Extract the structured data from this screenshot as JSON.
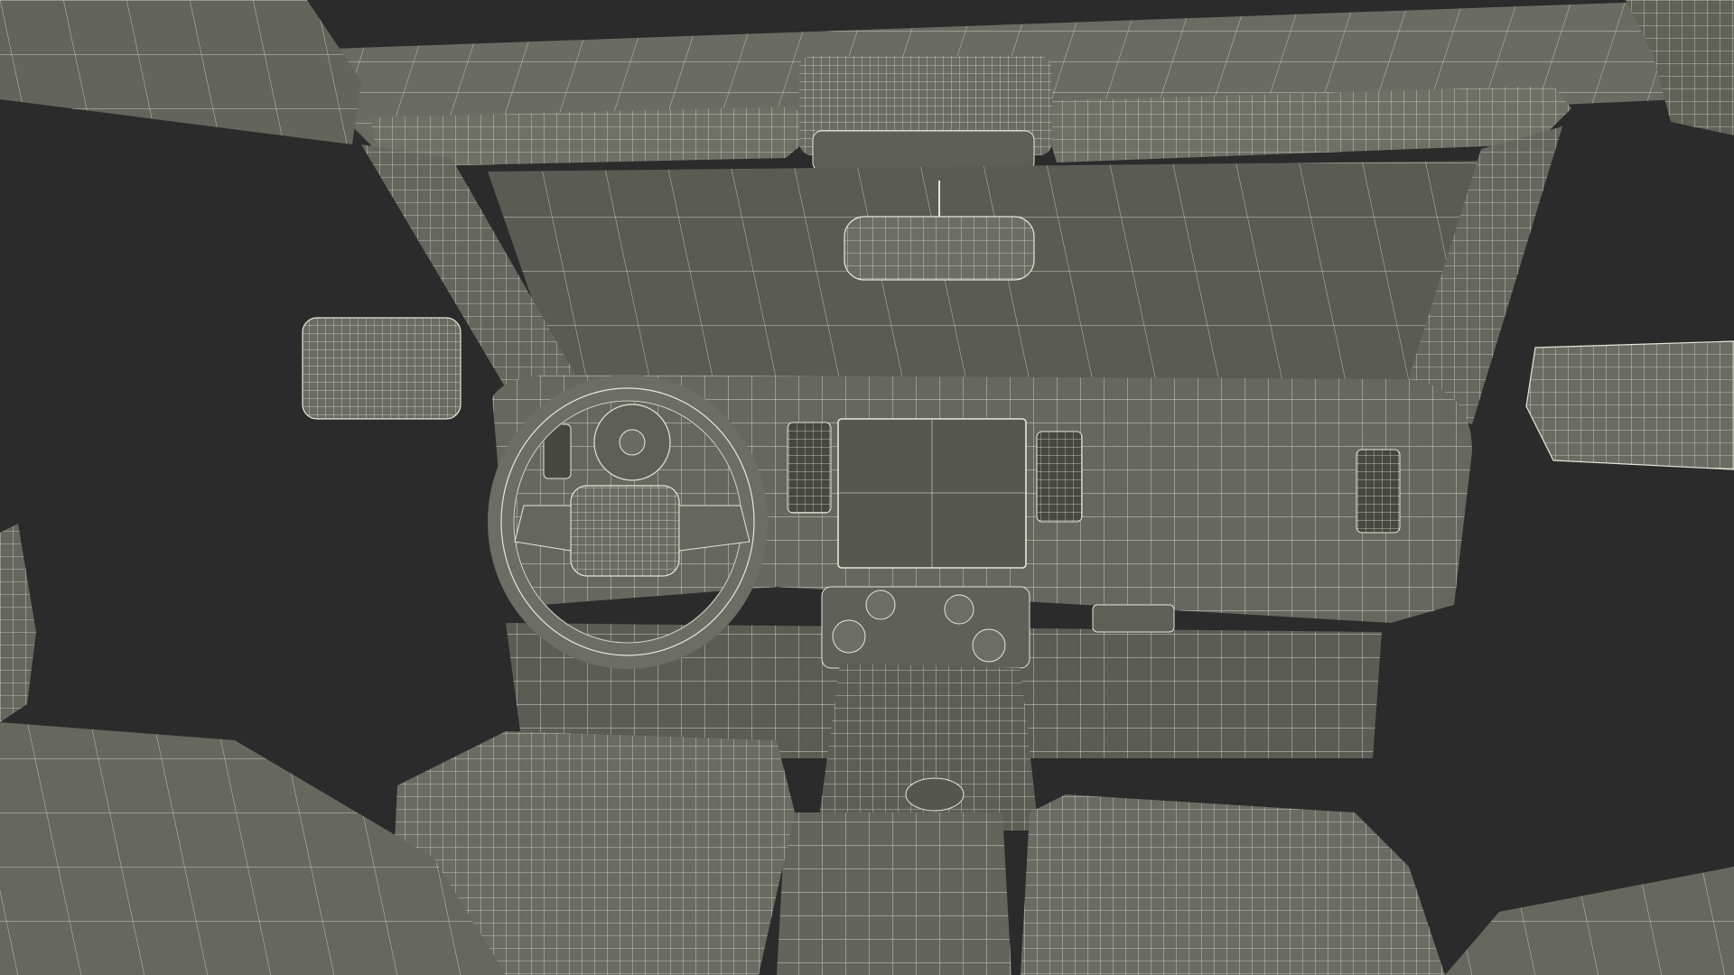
{
  "scene": {
    "background_color": "#2b2b2b",
    "surface_color": "#63655c",
    "surface_light_color": "#6e7066",
    "surface_dark_color": "#55574f",
    "wire_color": "#e6e6d8",
    "objects": [
      "roof-frame",
      "windshield",
      "sun-visors",
      "overhead-console",
      "rearview-mirror",
      "a-pillars",
      "side-mirrors",
      "dashboard",
      "steering-wheel",
      "instrument-gauge",
      "infotainment-screen",
      "air-vents",
      "center-console",
      "climate-controls",
      "glovebox",
      "front-seats",
      "rear-seats"
    ]
  }
}
